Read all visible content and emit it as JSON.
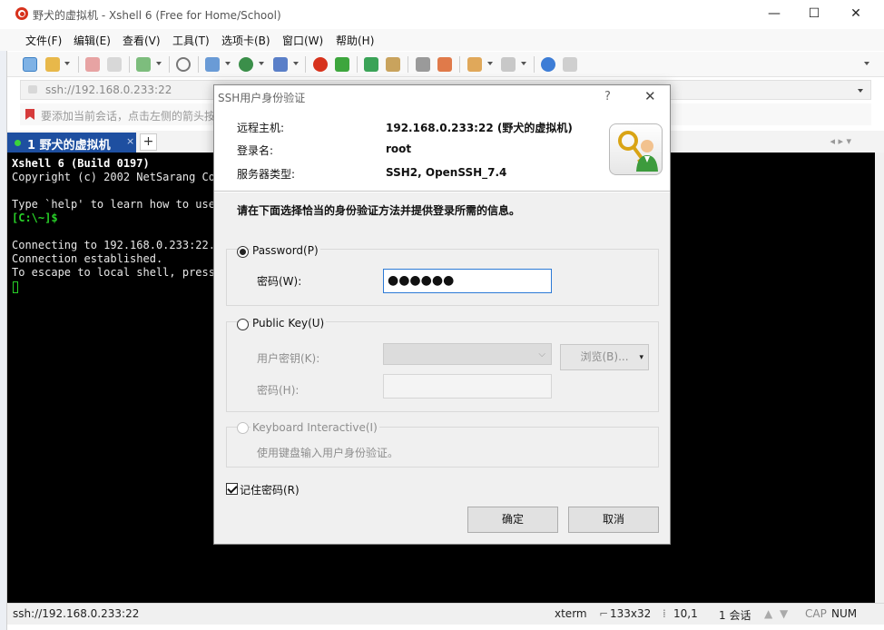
{
  "window": {
    "title": "野犬的虚拟机 - Xshell 6 (Free for Home/School)",
    "minimize": "—",
    "maximize": "☐",
    "close": "✕"
  },
  "menu": {
    "items": [
      "文件(F)",
      "编辑(E)",
      "查看(V)",
      "工具(T)",
      "选项卡(B)",
      "窗口(W)",
      "帮助(H)"
    ]
  },
  "address": {
    "value": "ssh://192.168.0.233:22"
  },
  "hint_bar": {
    "text": "要添加当前会话，点击左侧的箭头按"
  },
  "tab": {
    "label": "1 野犬的虚拟机",
    "close": "×",
    "add": "+",
    "nav": "◂ ▸  ▾"
  },
  "terminal": {
    "lines": [
      "Xshell 6 (Build 0197)",
      "Copyright (c) 2002 NetSarang Com",
      "",
      "Type `help' to learn how to use",
      "[C:\\~]$",
      "",
      "Connecting to 192.168.0.233:22..",
      "Connection established.",
      "To escape to local shell, press"
    ]
  },
  "status": {
    "address": "ssh://192.168.0.233:22",
    "term": "xterm",
    "size": "133x32",
    "cursor": "10,1",
    "sessions": "1 会话",
    "cap": "CAP",
    "num": "NUM"
  },
  "dialog": {
    "title": "SSH用户身份验证",
    "help": "?",
    "close": "✕",
    "info": {
      "remote_host_label": "远程主机:",
      "remote_host_value": "192.168.0.233:22 (野犬的虚拟机)",
      "login_label": "登录名:",
      "login_value": "root",
      "server_type_label": "服务器类型:",
      "server_type_value": "SSH2, OpenSSH_7.4"
    },
    "instruction": "请在下面选择恰当的身份验证方法并提供登录所需的信息。",
    "password": {
      "label": "Password(P)",
      "field_label": "密码(W):",
      "value": "●●●●●●"
    },
    "public_key": {
      "label": "Public Key(U)",
      "user_key_label": "用户密钥(K):",
      "browse": "浏览(B)...",
      "passphrase_label": "密码(H):"
    },
    "keyboard": {
      "label": "Keyboard Interactive(I)",
      "hint": "使用键盘输入用户身份验证。"
    },
    "remember": "记住密码(R)",
    "ok": "确定",
    "cancel": "取消"
  }
}
